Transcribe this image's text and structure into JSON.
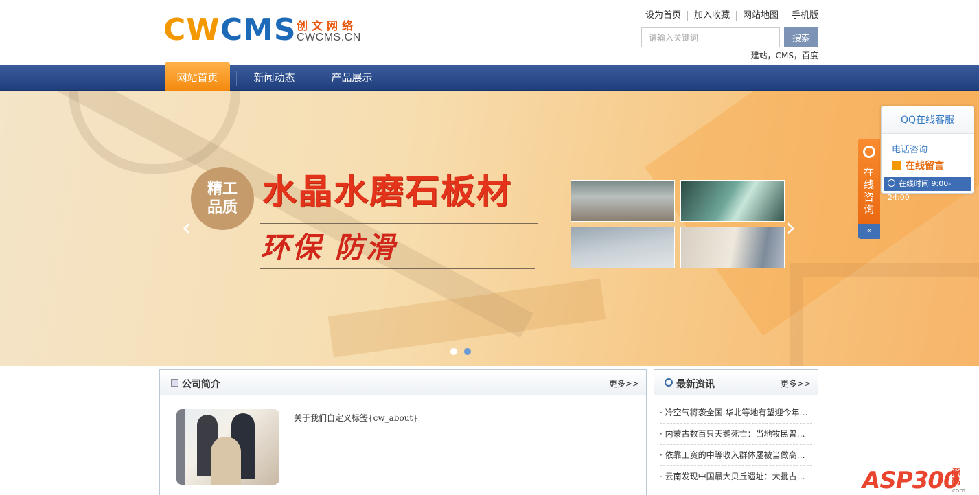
{
  "header": {
    "logo": {
      "main_c": "CW",
      "main_b": "CMS",
      "sub": "创文网络",
      "domain": "CWCMS.CN"
    },
    "toplinks": [
      "设为首页",
      "加入收藏",
      "网站地图",
      "手机版"
    ],
    "search": {
      "placeholder": "请输入关键词",
      "button": "搜索"
    },
    "hotwords": "建站，CMS，百度"
  },
  "nav": {
    "items": [
      "网站首页",
      "新闻动态",
      "产品展示"
    ],
    "active": 0
  },
  "banner": {
    "badge_line1": "精工",
    "badge_line2": "品质",
    "headline": "水晶水磨石板材",
    "subline": "环保 防滑",
    "prev": "‹",
    "next": "›",
    "slides": 2,
    "current": 1
  },
  "qq": {
    "tab": "在线咨询",
    "tab_bottom": "«",
    "title": "QQ在线客服",
    "phone": "电话咨询",
    "message": "在线留言",
    "time": "在线时间 9:00-24:00"
  },
  "about": {
    "title": "公司简介",
    "more": "更多>>",
    "text": "关于我们自定义标签{cw_about}"
  },
  "news": {
    "title": "最新资讯",
    "more": "更多>>",
    "items": [
      "· 冷空气将袭全国 华北等地有望迎今年…",
      "· 内蒙古数百只天鹅死亡：当地牧民曾…",
      "· 依靠工资的中等收入群体屡被当做高…",
      "· 云南发现中国最大贝丘遗址：大批古…"
    ]
  },
  "watermark": {
    "brand": "ASP300",
    "suffix": "源码",
    "tld": ".com"
  },
  "colors": {
    "nav": "#2a4b8c",
    "accent": "#f38a0e",
    "link": "#3579c3",
    "button": "#7d93b5"
  }
}
